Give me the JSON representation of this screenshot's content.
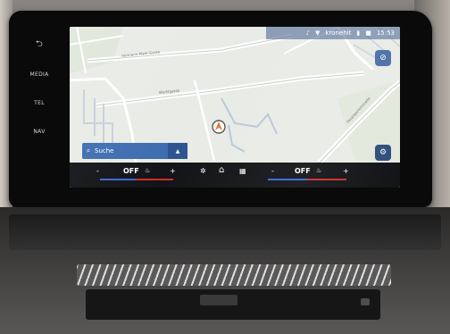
{
  "left_rail": {
    "back_label": "⮌",
    "items": [
      {
        "label": "MEDIA"
      },
      {
        "label": "TEL"
      },
      {
        "label": "NAV"
      }
    ]
  },
  "status_bar": {
    "station": "kronehit",
    "time": "15:53"
  },
  "map": {
    "streets": [
      {
        "label": "Hermann-Mark-Gasse"
      },
      {
        "label": "Wurtzgasse"
      },
      {
        "label": "Fasangartenstraße"
      }
    ],
    "icons": {
      "position_marker": "vehicle-position-icon",
      "map_mode": "view-toggle-icon",
      "poi_button": "settings-icon"
    }
  },
  "search": {
    "label": "Suche",
    "expand_icon": "▲"
  },
  "climate": {
    "left_minus": "-",
    "left_value": "OFF",
    "left_plus": "+",
    "right_minus": "-",
    "right_value": "OFF",
    "right_plus": "+",
    "fan_icon": "fan-icon",
    "home_icon": "home-icon",
    "apps_icon": "apps-grid-icon"
  },
  "colors": {
    "search_bg": "#3e6db0",
    "climate_bar": "#121418",
    "temp_blue": "#3a66d6",
    "temp_red": "#d02b2b"
  }
}
